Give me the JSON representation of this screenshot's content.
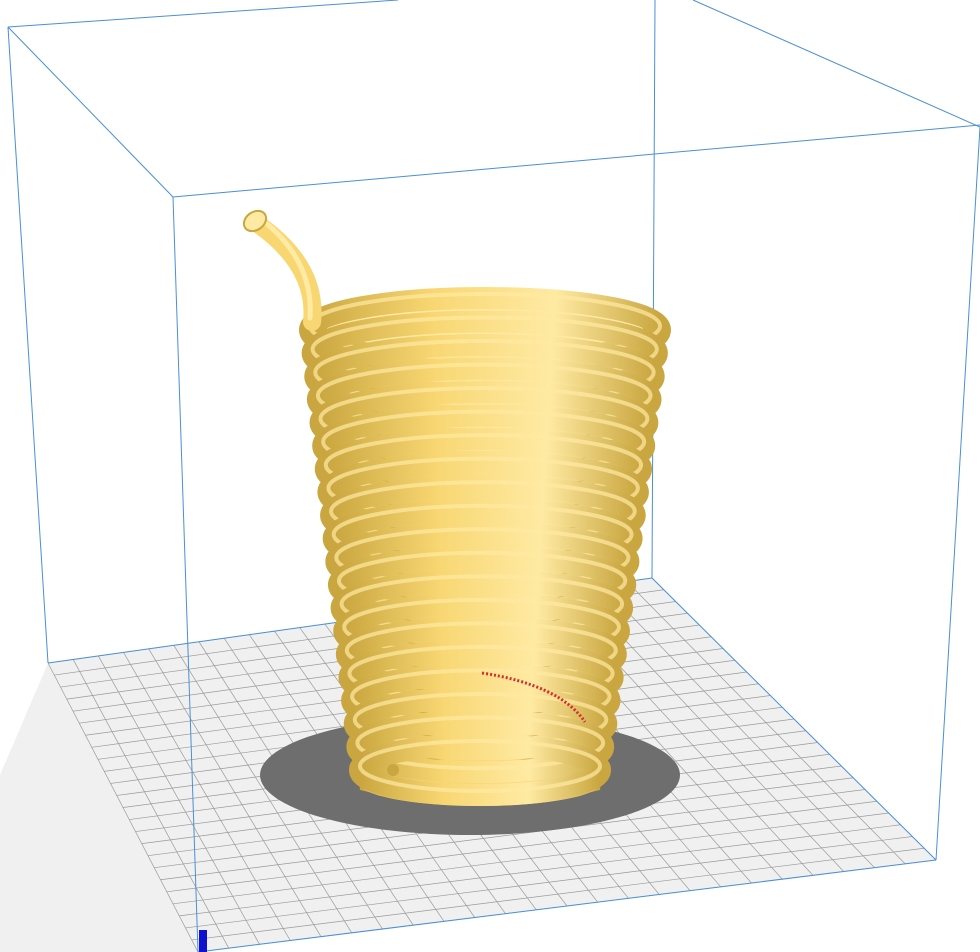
{
  "viewport": {
    "view": "3d-perspective",
    "model": "spiral-cup-with-straw",
    "colors": {
      "background": "#ffffff",
      "build_volume_edges": "#4a8fd6",
      "bed_surface": "#f0f0f0",
      "bed_grid": "#9a9a9a",
      "bed_shadow": "#6e6e6e",
      "model": "#f8d773",
      "model_highlight": "#ffeaa3",
      "model_shade": "#c9a63f",
      "axis_z": "#1010d0",
      "overhang": "#d03030"
    }
  }
}
